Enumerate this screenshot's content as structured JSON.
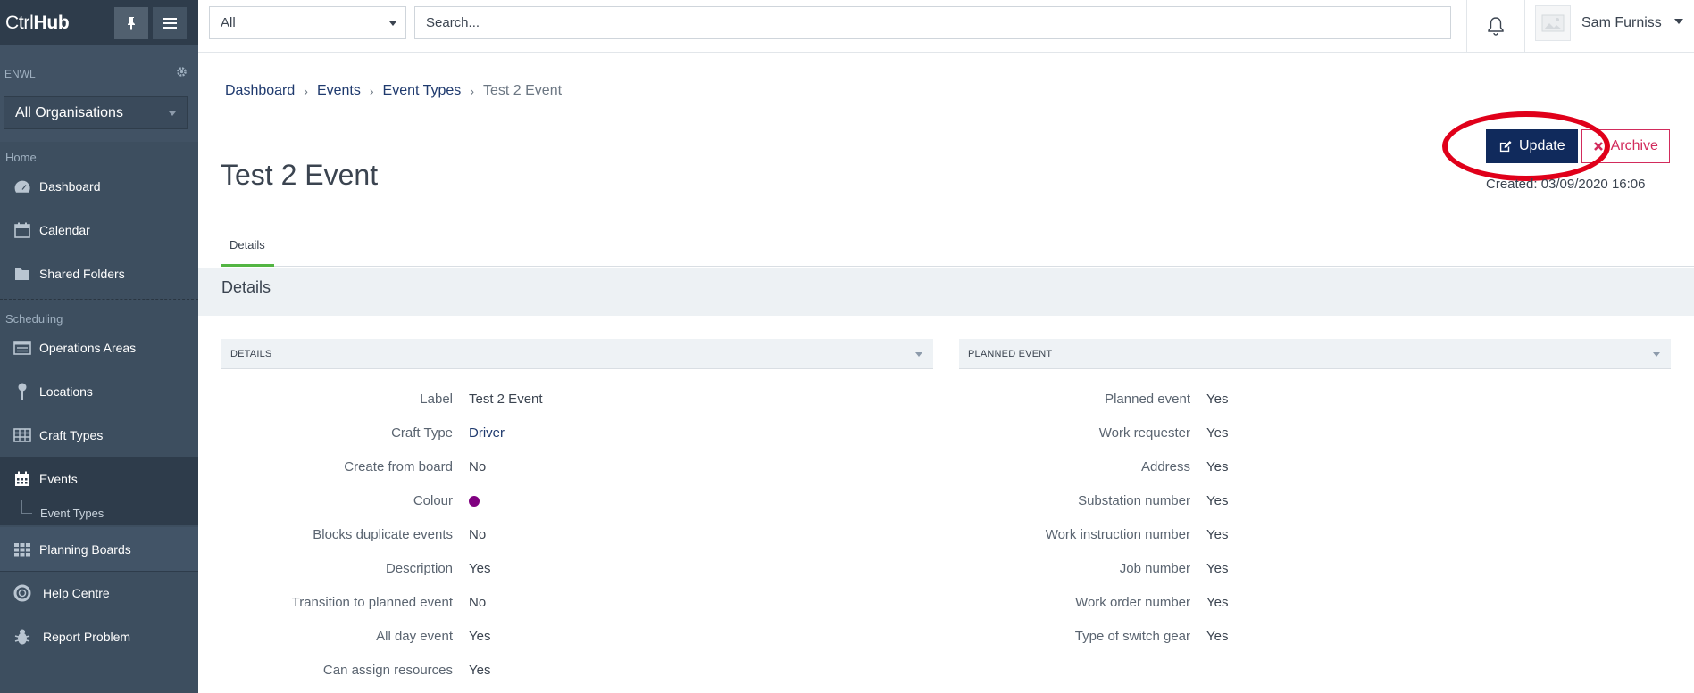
{
  "app": {
    "logo_ctrl": "Ctrl",
    "logo_hub": "Hub"
  },
  "sidebar": {
    "org_label": "ENWL",
    "org_select": "All Organisations",
    "sections": {
      "home": "Home",
      "scheduling": "Scheduling"
    },
    "items": {
      "dashboard": "Dashboard",
      "calendar": "Calendar",
      "shared_folders": "Shared Folders",
      "operations_areas": "Operations Areas",
      "locations": "Locations",
      "craft_types": "Craft Types",
      "events": "Events",
      "event_types": "Event Types",
      "planning_boards": "Planning Boards",
      "help_centre": "Help Centre",
      "report_problem": "Report Problem"
    }
  },
  "topbar": {
    "filter_value": "All",
    "search_placeholder": "Search...",
    "user_name": "Sam Furniss"
  },
  "breadcrumb": {
    "items": [
      "Dashboard",
      "Events",
      "Event Types"
    ],
    "current": "Test 2 Event"
  },
  "page": {
    "title": "Test 2 Event",
    "update_label": "Update",
    "archive_label": "Archive",
    "created": "Created: 03/09/2020 16:06",
    "tab": "Details",
    "section_title": "Details"
  },
  "details_panel": {
    "header": "DETAILS",
    "rows": [
      {
        "label": "Label",
        "value": "Test 2 Event"
      },
      {
        "label": "Craft Type",
        "value": "Driver"
      },
      {
        "label": "Create from board",
        "value": "No"
      },
      {
        "label": "Colour",
        "value": ""
      },
      {
        "label": "Blocks duplicate events",
        "value": "No"
      },
      {
        "label": "Description",
        "value": "Yes"
      },
      {
        "label": "Transition to planned event",
        "value": "No"
      },
      {
        "label": "All day event",
        "value": "Yes"
      },
      {
        "label": "Can assign resources",
        "value": "Yes"
      }
    ],
    "colour_value": "#800080"
  },
  "planned_panel": {
    "header": "PLANNED EVENT",
    "rows": [
      {
        "label": "Planned event",
        "value": "Yes"
      },
      {
        "label": "Work requester",
        "value": "Yes"
      },
      {
        "label": "Address",
        "value": "Yes"
      },
      {
        "label": "Substation number",
        "value": "Yes"
      },
      {
        "label": "Work instruction number",
        "value": "Yes"
      },
      {
        "label": "Job number",
        "value": "Yes"
      },
      {
        "label": "Work order number",
        "value": "Yes"
      },
      {
        "label": "Type of switch gear",
        "value": "Yes"
      }
    ]
  },
  "colors": {
    "sidebar_bg": "#3d4e5f",
    "primary": "#102a5c",
    "danger": "#d22b5c",
    "highlight": "#e0001a",
    "tab_active": "#53b543"
  }
}
